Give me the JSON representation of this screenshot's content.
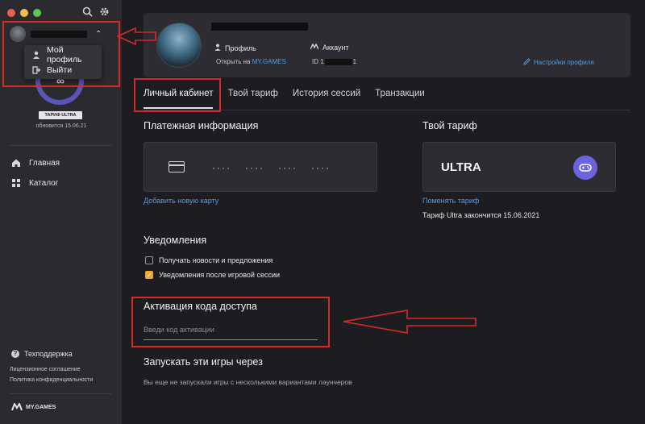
{
  "window": {
    "traffic_lights": [
      "#ec5f57",
      "#f4be4f",
      "#5fc553"
    ],
    "toolbar_icons": [
      "search-icon",
      "gear-icon"
    ]
  },
  "sidebar": {
    "user_chevron": "⌃",
    "menu": [
      {
        "label": "Мой профиль",
        "icon": "user-icon"
      },
      {
        "label": "Выйти",
        "icon": "logout-icon"
      }
    ],
    "ring_symbol": "∞",
    "plan_badge": "ТАРИФ ULTRA",
    "renew_text": "обновится 15.06.21",
    "nav": [
      {
        "label": "Главная",
        "icon": "home-icon"
      },
      {
        "label": "Каталог",
        "icon": "grid-icon"
      }
    ],
    "support_label": "Техподдержка",
    "legal": [
      "Лицензионное соглашение",
      "Политика конфиденциальности"
    ],
    "brand": "MY.GAMES"
  },
  "header": {
    "profile_label": "Профиль",
    "account_label": "Аккаунт",
    "open_in_prefix": "Открыть на",
    "open_in_link": "MY.GAMES",
    "id_prefix": "ID 1",
    "id_suffix": "1",
    "settings_link": "Настройки профиля"
  },
  "tabs": [
    "Личный кабинет",
    "Твой тариф",
    "История сессий",
    "Транзакции"
  ],
  "payment": {
    "title": "Платежная информация",
    "masked": [
      "····",
      "····",
      "····",
      "····"
    ],
    "add_card": "Добавить новую карту"
  },
  "plan": {
    "title": "Твой тариф",
    "name": "ULTRA",
    "change_link": "Поменять тариф",
    "expires": "Тариф Ultra закончится 15.06.2021"
  },
  "notifications": {
    "title": "Уведомления",
    "options": [
      {
        "label": "Получать новости и предложения",
        "checked": false
      },
      {
        "label": "Уведомления после игровой сессии",
        "checked": true
      }
    ]
  },
  "activation": {
    "title": "Активация кода доступа",
    "placeholder": "Введи код активации"
  },
  "launchers": {
    "title": "Запускать эти игры через",
    "empty_text": "Вы еще не запускали игры с несколькими вариантами лаунчеров"
  },
  "annotation_color": "#d42a2a",
  "accent": "#6c63e0",
  "link_color": "#4d9ee8"
}
